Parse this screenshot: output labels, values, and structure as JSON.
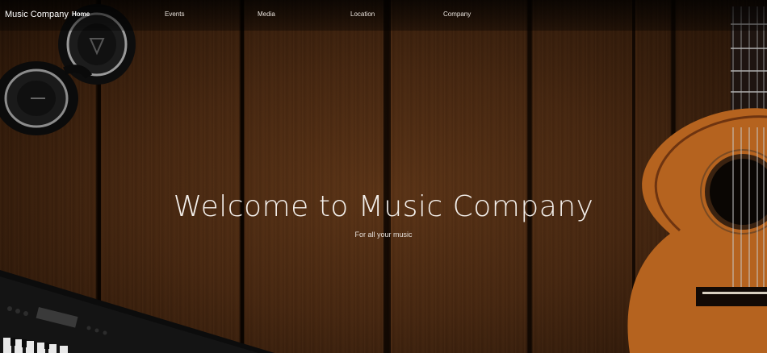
{
  "navbar": {
    "brand": "Music Company",
    "links": [
      {
        "label": "Home",
        "active": true
      },
      {
        "label": "Events",
        "active": false
      },
      {
        "label": "Media",
        "active": false
      },
      {
        "label": "Location",
        "active": false
      },
      {
        "label": "Company",
        "active": false
      }
    ]
  },
  "hero": {
    "title": "Welcome to Music Company",
    "subtitle": "For all your music"
  },
  "colors": {
    "wood_dark": "#2a1608",
    "wood_mid": "#5a3316",
    "text": "#f4f0ec"
  },
  "icons": [
    "headphones-icon",
    "guitar-icon",
    "keyboard-icon"
  ]
}
